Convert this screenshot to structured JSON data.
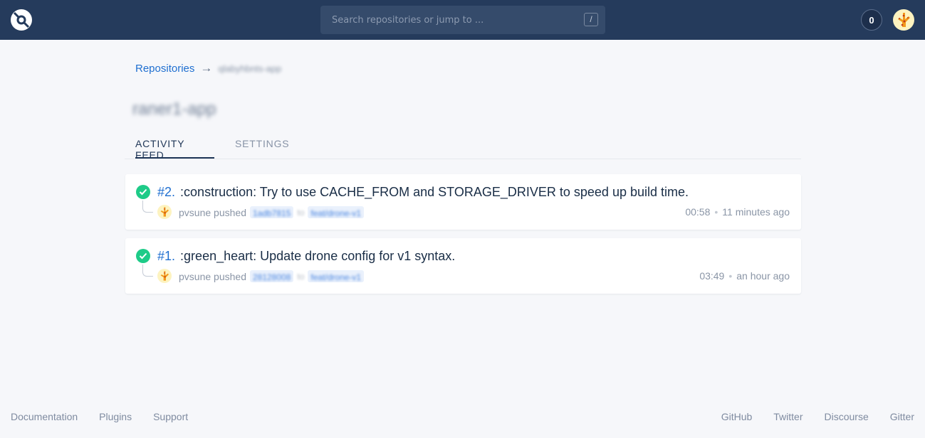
{
  "topbar": {
    "logo_icon": "drone-logo-icon",
    "search": {
      "placeholder": "Search repositories or jump to ...",
      "value": "",
      "shortcut": "/"
    },
    "notifications_count": "0",
    "avatar_icon": "giraffe-avatar-icon"
  },
  "breadcrumb": {
    "root_label": "Repositories",
    "separator": "→",
    "current": "qlabyhbnts-app"
  },
  "page_title": "raner1-app",
  "tabs": [
    {
      "label": "ACTIVITY FEED",
      "active": true
    },
    {
      "label": "SETTINGS",
      "active": false
    }
  ],
  "builds": [
    {
      "status": "success",
      "number": "#2.",
      "message": ":construction: Try to use CACHE_FROM and STORAGE_DRIVER to speed up build time.",
      "author": "pvsune",
      "action": "pushed",
      "commit": "1adb7815",
      "to": "to",
      "branch": "feat/drone-v1",
      "time": "00:58",
      "ago": "11 minutes ago"
    },
    {
      "status": "success",
      "number": "#1.",
      "message": ":green_heart: Update drone config for v1 syntax.",
      "author": "pvsune",
      "action": "pushed",
      "commit": "28128008",
      "to": "to",
      "branch": "feat/drone-v1",
      "time": "03:49",
      "ago": "an hour ago"
    }
  ],
  "footer": {
    "left": [
      "Documentation",
      "Plugins",
      "Support"
    ],
    "right": [
      "GitHub",
      "Twitter",
      "Discourse",
      "Gitter"
    ]
  },
  "colors": {
    "topbar": "#253b5c",
    "accent_link": "#1f6fd0",
    "success": "#1ecb88",
    "background": "#f6f7fa"
  }
}
